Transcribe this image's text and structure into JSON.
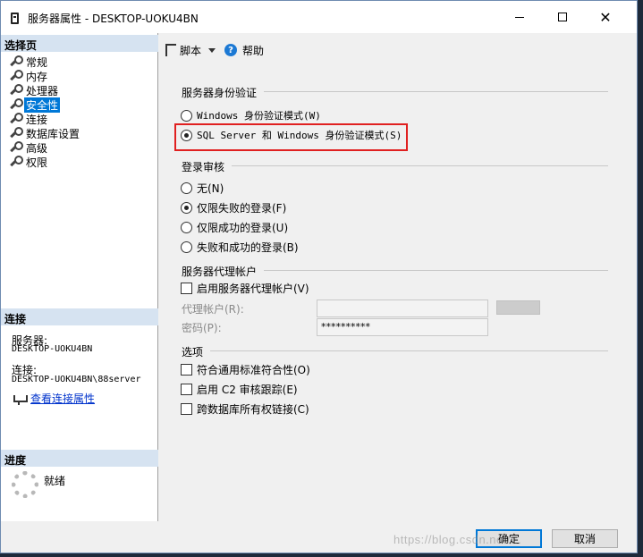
{
  "window": {
    "title": "服务器属性 - DESKTOP-UOKU4BN"
  },
  "left_pane": {
    "select_page_header": "选择页",
    "items": [
      {
        "label": "常规",
        "selected": false
      },
      {
        "label": "内存",
        "selected": false
      },
      {
        "label": "处理器",
        "selected": false
      },
      {
        "label": "安全性",
        "selected": true
      },
      {
        "label": "连接",
        "selected": false
      },
      {
        "label": "数据库设置",
        "selected": false
      },
      {
        "label": "高级",
        "selected": false
      },
      {
        "label": "权限",
        "selected": false
      }
    ],
    "connection_header": "连接",
    "server_label": "服务器:",
    "server_value": "DESKTOP-UOKU4BN",
    "connection_label": "连接:",
    "connection_value": "DESKTOP-UOKU4BN\\88server",
    "view_connection_link": "查看连接属性",
    "progress_header": "进度",
    "progress_status": "就绪"
  },
  "toolbar": {
    "script_label": "脚本",
    "help_label": "帮助"
  },
  "auth": {
    "group_title": "服务器身份验证",
    "options": [
      {
        "label": "Windows 身份验证模式(W)",
        "checked": false
      },
      {
        "label": "SQL Server 和 Windows 身份验证模式(S)",
        "checked": true
      }
    ]
  },
  "audit": {
    "group_title": "登录审核",
    "options": [
      {
        "label": "无(N)",
        "checked": false
      },
      {
        "label": "仅限失败的登录(F)",
        "checked": true
      },
      {
        "label": "仅限成功的登录(U)",
        "checked": false
      },
      {
        "label": "失败和成功的登录(B)",
        "checked": false
      }
    ]
  },
  "proxy": {
    "group_title": "服务器代理帐户",
    "enable_label": "启用服务器代理帐户(V)",
    "enabled": false,
    "account_label": "代理帐户(R):",
    "account_value": "",
    "password_label": "密码(P):",
    "password_value": "**********"
  },
  "options": {
    "group_title": "选项",
    "items": [
      {
        "label": "符合通用标准符合性(O)",
        "checked": false
      },
      {
        "label": "启用 C2 审核跟踪(E)",
        "checked": false
      },
      {
        "label": "跨数据库所有权链接(C)",
        "checked": false
      }
    ]
  },
  "buttons": {
    "ok": "确定",
    "cancel": "取消"
  },
  "watermark": "https://blog.csdn.net/..."
}
